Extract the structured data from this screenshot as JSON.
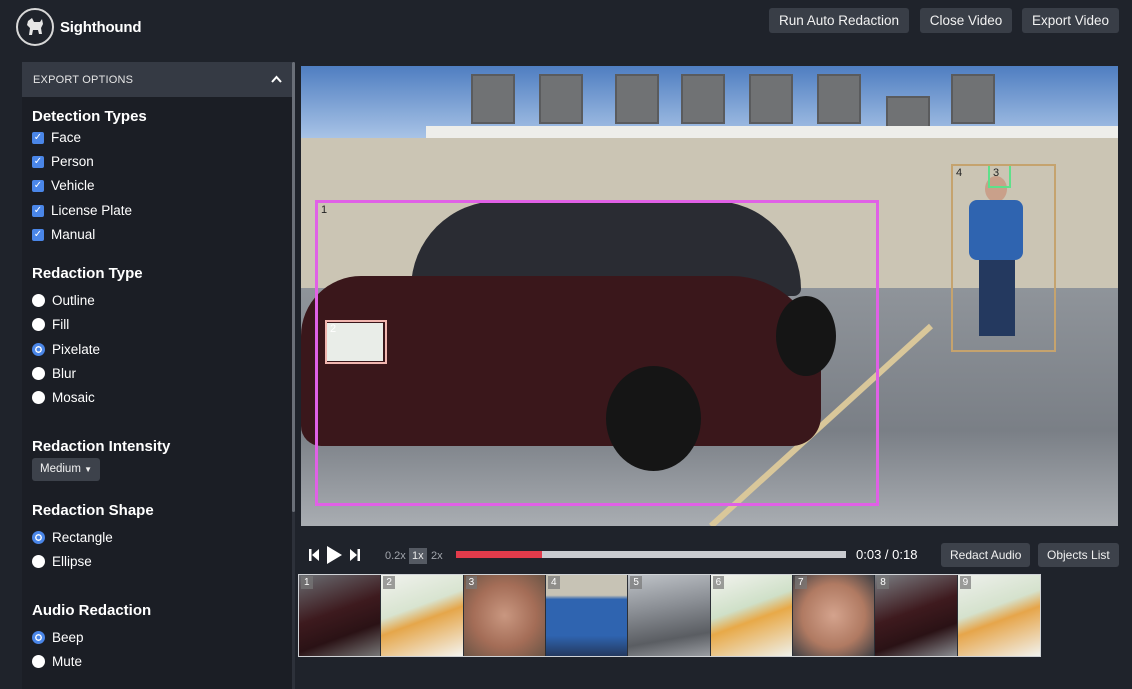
{
  "app": {
    "name": "Sighthound"
  },
  "toolbar": {
    "run_auto_redaction": "Run Auto Redaction",
    "close_video": "Close Video",
    "export_video": "Export Video"
  },
  "sidebar": {
    "header": "EXPORT OPTIONS",
    "detection_types": {
      "title": "Detection Types",
      "items": [
        {
          "label": "Face",
          "checked": true
        },
        {
          "label": "Person",
          "checked": true
        },
        {
          "label": "Vehicle",
          "checked": true
        },
        {
          "label": "License Plate",
          "checked": true
        },
        {
          "label": "Manual",
          "checked": true
        }
      ]
    },
    "redaction_type": {
      "title": "Redaction Type",
      "items": [
        {
          "label": "Outline",
          "selected": false
        },
        {
          "label": "Fill",
          "selected": false
        },
        {
          "label": "Pixelate",
          "selected": true
        },
        {
          "label": "Blur",
          "selected": false
        },
        {
          "label": "Mosaic",
          "selected": false
        }
      ]
    },
    "redaction_intensity": {
      "title": "Redaction Intensity",
      "value": "Medium"
    },
    "redaction_shape": {
      "title": "Redaction Shape",
      "items": [
        {
          "label": "Rectangle",
          "selected": true
        },
        {
          "label": "Ellipse",
          "selected": false
        }
      ]
    },
    "audio_redaction": {
      "title": "Audio Redaction",
      "items": [
        {
          "label": "Beep",
          "selected": true
        },
        {
          "label": "Mute",
          "selected": false
        }
      ]
    }
  },
  "video": {
    "detections": [
      {
        "id": "1",
        "kind": "vehicle",
        "color": "#e060e6"
      },
      {
        "id": "2",
        "kind": "license-plate",
        "color": "#f1b6b0"
      },
      {
        "id": "3",
        "kind": "face",
        "color": "#5fe08a"
      },
      {
        "id": "4",
        "kind": "person",
        "color": "#c5a36e"
      }
    ]
  },
  "player": {
    "speeds": [
      "0.2x",
      "1x",
      "2x"
    ],
    "active_speed": "1x",
    "current_time": "0:03",
    "duration": "0:18",
    "time_display": "0:03 / 0:18",
    "progress": 0.22,
    "redact_audio": "Redact Audio",
    "objects_list": "Objects List"
  },
  "thumbnails": [
    {
      "num": "1",
      "kind": "vehicle"
    },
    {
      "num": "2",
      "kind": "license-plate"
    },
    {
      "num": "3",
      "kind": "face"
    },
    {
      "num": "4",
      "kind": "person"
    },
    {
      "num": "5",
      "kind": "vehicle"
    },
    {
      "num": "6",
      "kind": "license-plate"
    },
    {
      "num": "7",
      "kind": "face"
    },
    {
      "num": "8",
      "kind": "vehicle"
    },
    {
      "num": "9",
      "kind": "license-plate"
    }
  ]
}
